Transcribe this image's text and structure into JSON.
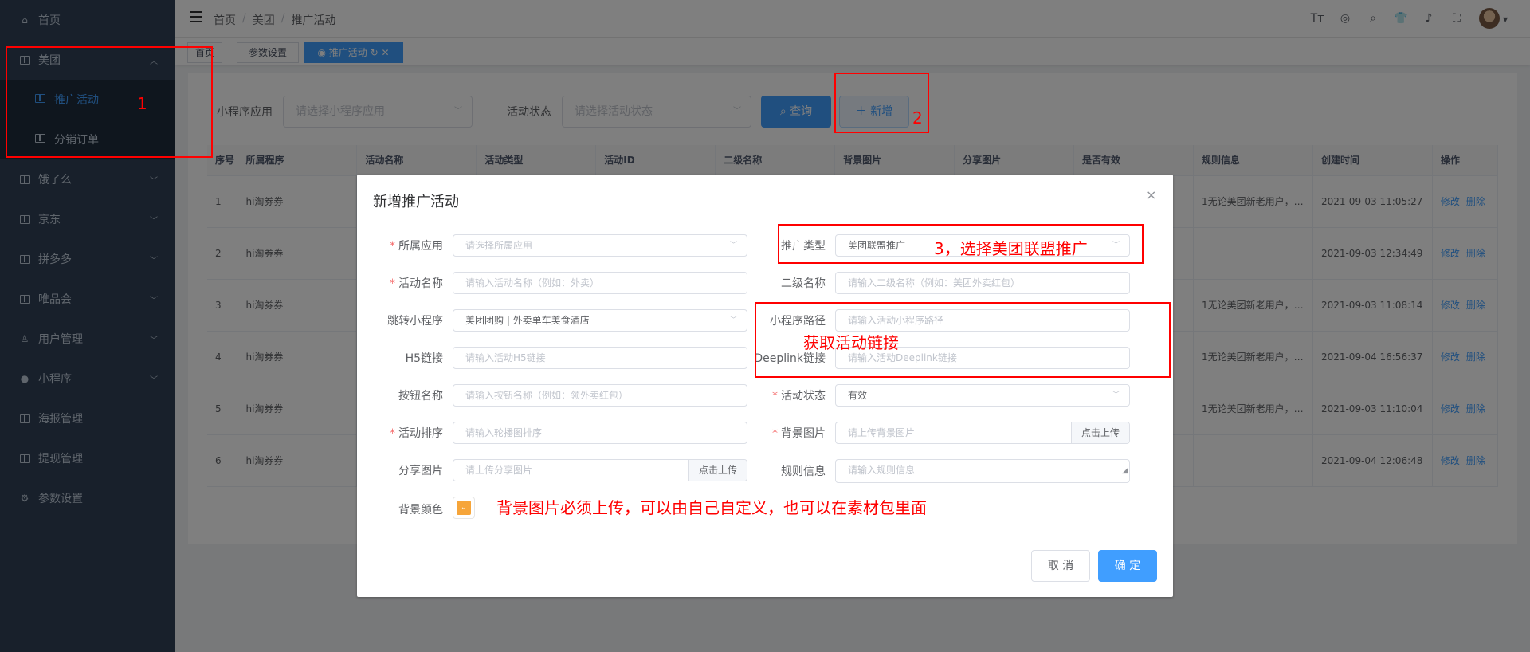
{
  "sidebar": {
    "items": [
      {
        "label": "首页",
        "icon": "home-icon"
      },
      {
        "label": "美团",
        "icon": "book-icon",
        "expanded": true,
        "children": [
          {
            "label": "推广活动",
            "active": true
          },
          {
            "label": "分销订单"
          }
        ]
      },
      {
        "label": "饿了么",
        "icon": "book-icon"
      },
      {
        "label": "京东",
        "icon": "book-icon"
      },
      {
        "label": "拼多多",
        "icon": "book-icon"
      },
      {
        "label": "唯品会",
        "icon": "book-icon"
      },
      {
        "label": "用户管理",
        "icon": "user-icon"
      },
      {
        "label": "小程序",
        "icon": "wechat-icon"
      },
      {
        "label": "海报管理",
        "icon": "briefcase-icon"
      },
      {
        "label": "提现管理",
        "icon": "briefcase-icon"
      },
      {
        "label": "参数设置",
        "icon": "gear-icon"
      }
    ]
  },
  "header": {
    "breadcrumb": [
      "首页",
      "美团",
      "推广活动"
    ],
    "icons": [
      "font-size-icon",
      "github-icon",
      "search-icon",
      "shirt-icon",
      "bell-icon",
      "fullscreen-icon",
      "avatar"
    ]
  },
  "tags": [
    {
      "label": "首页"
    },
    {
      "label": "参数设置"
    },
    {
      "label": "推广活动",
      "active": true
    }
  ],
  "filter": {
    "app_label": "小程序应用",
    "app_placeholder": "请选择小程序应用",
    "status_label": "活动状态",
    "status_placeholder": "请选择活动状态",
    "search_button": "查询",
    "add_button": "新增"
  },
  "table": {
    "headers": [
      "序号",
      "所属程序",
      "活动名称",
      "活动类型",
      "活动ID",
      "二级名称",
      "背景图片",
      "分享图片",
      "是否有效",
      "规则信息",
      "创建时间",
      "操作"
    ],
    "rows": [
      {
        "index": "1",
        "app": "hi淘券券",
        "rule": "1无论美团新老用户，…",
        "created": "2021-09-03 11:05:27"
      },
      {
        "index": "2",
        "app": "hi淘券券",
        "rule": "",
        "created": "2021-09-03 12:34:49"
      },
      {
        "index": "3",
        "app": "hi淘券券",
        "rule": "1无论美团新老用户，…",
        "created": "2021-09-03 11:08:14"
      },
      {
        "index": "4",
        "app": "hi淘券券",
        "rule": "1无论美团新老用户，…",
        "created": "2021-09-04 16:56:37"
      },
      {
        "index": "5",
        "app": "hi淘券券",
        "rule": "1无论美团新老用户，…",
        "created": "2021-09-03 11:10:04"
      },
      {
        "index": "6",
        "app": "hi淘券券",
        "rule": "",
        "created": "2021-09-04 12:06:48"
      }
    ],
    "edit_label": "修改",
    "delete_label": "删除"
  },
  "dialog": {
    "title": "新增推广活动",
    "close": "×",
    "fields": {
      "app": {
        "label": "所属应用",
        "placeholder": "请选择所属应用"
      },
      "promo_type": {
        "label": "推广类型",
        "value": "美团联盟推广"
      },
      "activity_name": {
        "label": "活动名称",
        "placeholder": "请输入活动名称（例如：外卖）"
      },
      "sub_name": {
        "label": "二级名称",
        "placeholder": "请输入二级名称（例如：美团外卖红包）"
      },
      "jump_app": {
        "label": "跳转小程序",
        "value": "美团团购 | 外卖单车美食酒店"
      },
      "mp_path": {
        "label": "小程序路径",
        "placeholder": "请输入活动小程序路径"
      },
      "h5_link": {
        "label": "H5链接",
        "placeholder": "请输入活动H5链接"
      },
      "deeplink": {
        "label": "Deeplink链接",
        "placeholder": "请输入活动Deeplink链接"
      },
      "button_name": {
        "label": "按钮名称",
        "placeholder": "请输入按钮名称（例如：领外卖红包）"
      },
      "status": {
        "label": "活动状态",
        "value": "有效"
      },
      "sort": {
        "label": "活动排序",
        "placeholder": "请输入轮播图排序"
      },
      "bg_image": {
        "label": "背景图片",
        "placeholder": "请上传背景图片",
        "upload": "点击上传"
      },
      "share_image": {
        "label": "分享图片",
        "placeholder": "请上传分享图片",
        "upload": "点击上传"
      },
      "rules": {
        "label": "规则信息",
        "placeholder": "请输入规则信息"
      },
      "bg_color": {
        "label": "背景颜色",
        "color": "#f6a53a"
      }
    },
    "cancel": "取 消",
    "confirm": "确 定"
  },
  "annotations": {
    "one": "1",
    "two": "2",
    "three": "3，选择美团联盟推广",
    "link": "获取活动链接",
    "bg_note": "背景图片必须上传，可以由自己自定义，也可以在素材包里面"
  }
}
